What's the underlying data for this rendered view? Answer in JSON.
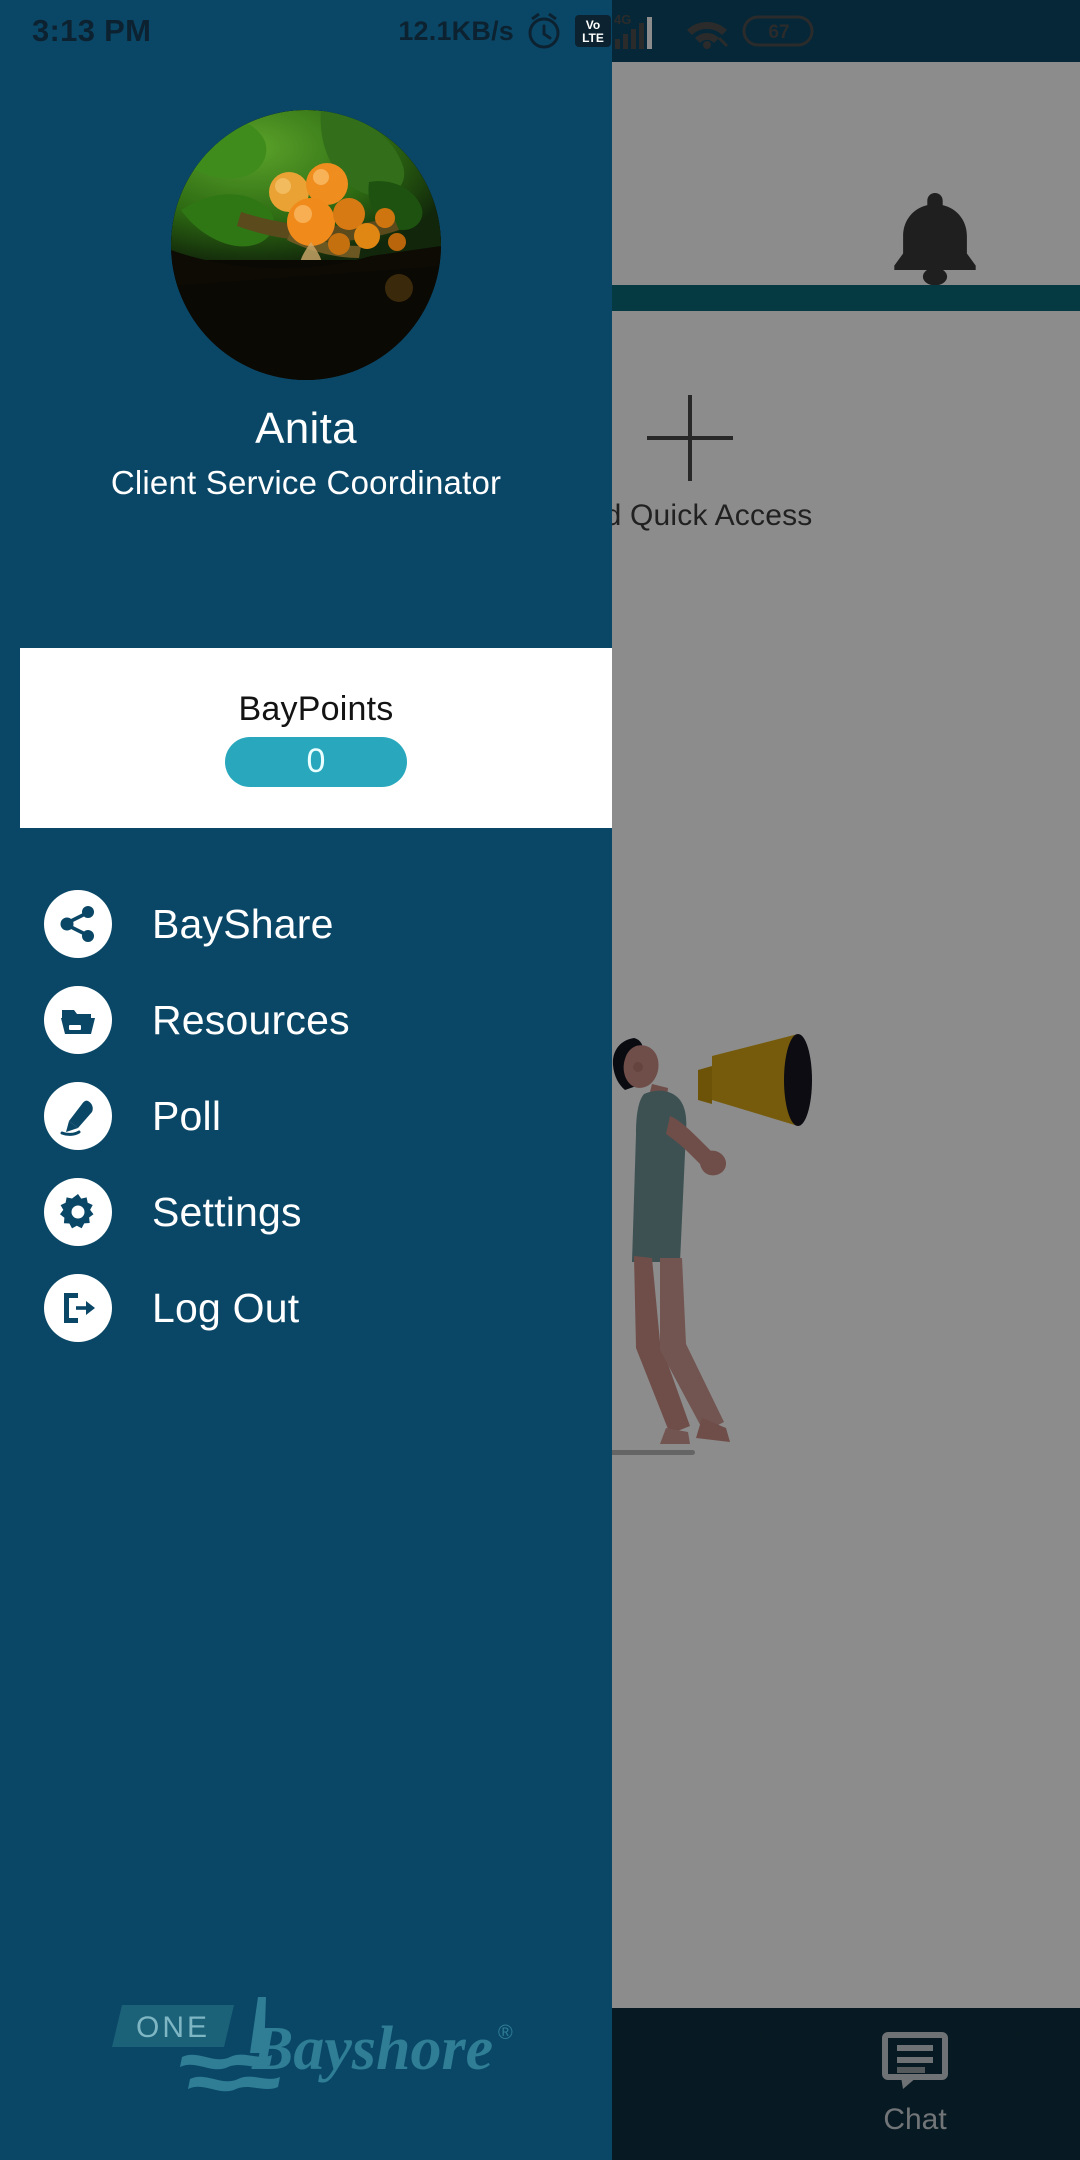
{
  "status_bar": {
    "time": "3:13 PM",
    "network_speed": "12.1KB/s",
    "icons": [
      "alarm-icon",
      "volte-icon",
      "signal-4g-icon",
      "wifi-icon",
      "battery-icon"
    ],
    "volte_label_top": "Vo",
    "volte_label_bottom": "LTE",
    "network_type": "4G",
    "battery_level": "67"
  },
  "drawer": {
    "profile": {
      "name": "Anita",
      "role": "Client Service Coordinator",
      "avatar_name": "user-avatar-photo"
    },
    "points": {
      "label": "BayPoints",
      "value": "0",
      "pill_color": "#29a8bd"
    },
    "menu": [
      {
        "id": "bayshare",
        "label": "BayShare",
        "icon": "share-icon"
      },
      {
        "id": "resources",
        "label": "Resources",
        "icon": "folder-icon"
      },
      {
        "id": "poll",
        "label": "Poll",
        "icon": "pen-signature-icon"
      },
      {
        "id": "settings",
        "label": "Settings",
        "icon": "gear-icon"
      },
      {
        "id": "logout",
        "label": "Log Out",
        "icon": "logout-icon"
      }
    ],
    "brand": {
      "tag": "ONE",
      "name": "Bayshore",
      "trademark": "®"
    },
    "background_color": "#0a4767"
  },
  "background_app": {
    "notification_icon": "bell-icon",
    "quick_access": {
      "label": "Add Quick Access",
      "icon": "plus-icon"
    },
    "illustration_name": "woman-with-megaphone-illustration",
    "bottom_nav": [
      {
        "id": "chat",
        "label": "Chat",
        "icon": "chat-bubble-icon"
      }
    ],
    "divider_color": "#0c6a78"
  }
}
